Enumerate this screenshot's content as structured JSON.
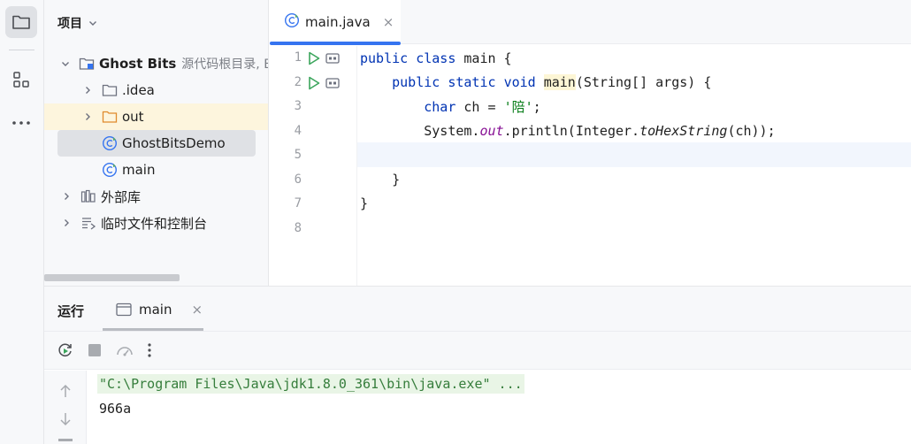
{
  "project_panel": {
    "title": "项目",
    "tree": [
      {
        "label": "Ghost Bits",
        "sub": "源代码根目录, E",
        "icon": "module-folder-icon"
      },
      {
        "label": ".idea",
        "icon": "folder-icon"
      },
      {
        "label": "out",
        "icon": "folder-icon"
      },
      {
        "label": "GhostBitsDemo",
        "icon": "java-class-icon"
      },
      {
        "label": "main",
        "icon": "java-class-icon"
      },
      {
        "label": "外部库",
        "icon": "library-icon"
      },
      {
        "label": "临时文件和控制台",
        "icon": "scratch-icon"
      }
    ]
  },
  "editor": {
    "tab": {
      "label": "main.java",
      "close": "×"
    },
    "line_numbers": [
      "1",
      "2",
      "3",
      "4",
      "5",
      "6",
      "7",
      "8"
    ],
    "code": {
      "l1": {
        "kw1": "public",
        "kw2": "class",
        "rest": " main {"
      },
      "l2": {
        "kw1": "public",
        "kw2": "static",
        "kw3": "void",
        "fn": "main",
        "rest": "(String[] args) {"
      },
      "l3": {
        "kw": "char",
        "mid": " ch = ",
        "str": "'陪'",
        "end": ";"
      },
      "l4": {
        "a": "System.",
        "field": "out",
        "b": ".println(Integer.",
        "method": "toHexString",
        "c": "(ch));"
      },
      "l6": "}",
      "l7": "}"
    }
  },
  "run_panel": {
    "title": "运行",
    "tab": {
      "label": "main",
      "close": "×"
    },
    "console": {
      "command": "\"C:\\Program Files\\Java\\jdk1.8.0_361\\bin\\java.exe\" ...",
      "output": "966a"
    }
  },
  "colors": {
    "accent": "#3574f0",
    "keyword": "#0033b3",
    "string": "#067d17",
    "static_field": "#871094"
  }
}
